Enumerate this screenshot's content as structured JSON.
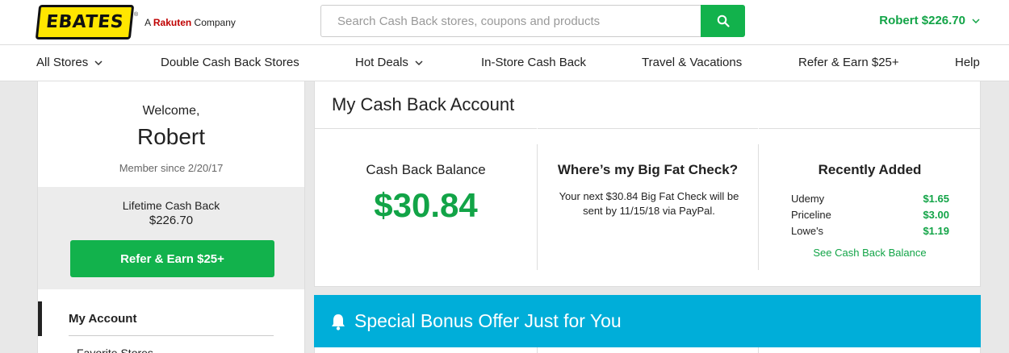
{
  "header": {
    "logo_text": "EBATES",
    "logo_reg": "®",
    "tagline_prefix": "A",
    "tagline_brand": "Rakuten",
    "tagline_suffix": "Company",
    "search_placeholder": "Search Cash Back stores, coupons and products",
    "search_icon": "search-icon",
    "user_label": "Robert $226.70"
  },
  "nav": {
    "items": [
      {
        "label": "All Stores",
        "has_dropdown": true
      },
      {
        "label": "Double Cash Back Stores",
        "has_dropdown": false
      },
      {
        "label": "Hot Deals",
        "has_dropdown": true
      },
      {
        "label": "In-Store Cash Back",
        "has_dropdown": false
      },
      {
        "label": "Travel & Vacations",
        "has_dropdown": false
      },
      {
        "label": "Refer & Earn $25+",
        "has_dropdown": false
      },
      {
        "label": "Help",
        "has_dropdown": false
      }
    ]
  },
  "sidebar": {
    "welcome": "Welcome,",
    "username": "Robert",
    "member_since": "Member since 2/20/17",
    "lifetime_label": "Lifetime Cash Back",
    "lifetime_value": "$226.70",
    "refer_button": "Refer & Earn $25+",
    "account_items": [
      "My Account",
      "Favorite Stores"
    ]
  },
  "account": {
    "title": "My Cash Back Account",
    "balance_heading": "Cash Back Balance",
    "balance_amount": "$30.84",
    "check_heading": "Where’s my Big Fat Check?",
    "check_text": "Your next $30.84 Big Fat Check will be sent by 11/15/18 via PayPal.",
    "recent_heading": "Recently Added",
    "recent_items": [
      {
        "store": "Udemy",
        "amount": "$1.65"
      },
      {
        "store": "Priceline",
        "amount": "$3.00"
      },
      {
        "store": "Lowe's",
        "amount": "$1.19"
      }
    ],
    "see_balance_link": "See Cash Back Balance"
  },
  "bonus": {
    "title": "Special Bonus Offer Just for You",
    "icon": "bell-icon"
  },
  "colors": {
    "green": "#12b24c",
    "green_text": "#12a447",
    "bonus_blue": "#00aed9",
    "logo_yellow": "#ffe600"
  }
}
